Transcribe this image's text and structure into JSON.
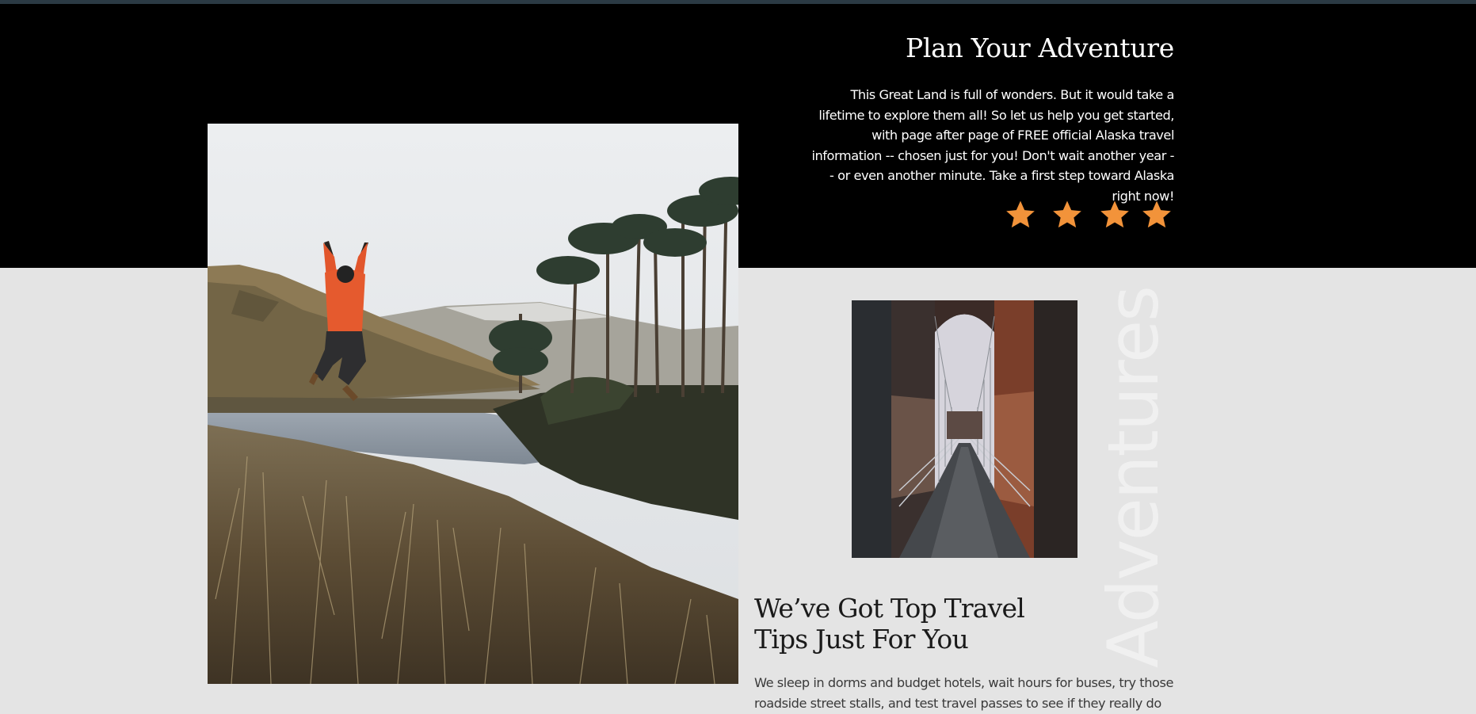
{
  "hero": {
    "title": "Plan Your Adventure",
    "body": "This Great Land is full of wonders. But it would take a lifetime to explore them all! So let us help you get started, with page after page of FREE official Alaska travel information -- chosen just for you! Don't wait another year -- or even another minute. Take a first step toward Alaska right now!",
    "rating": {
      "value": 4,
      "max": 4,
      "icon": "star-icon",
      "color": "#f2933a"
    }
  },
  "images": {
    "main": {
      "icon": "photo-man-jumping-by-lake"
    },
    "side": {
      "icon": "photo-suspension-bridge"
    }
  },
  "section": {
    "vertical_word": "Adventures",
    "title_line1": "We’ve Got Top Travel",
    "title_line2": "Tips Just For You",
    "body": "We sleep in dorms and budget hotels, wait hours for buses, try those roadside street stalls, and test travel passes to see if they really do"
  },
  "colors": {
    "hero_bg": "#000000",
    "page_bg": "#e4e4e4",
    "accent": "#f2933a"
  }
}
